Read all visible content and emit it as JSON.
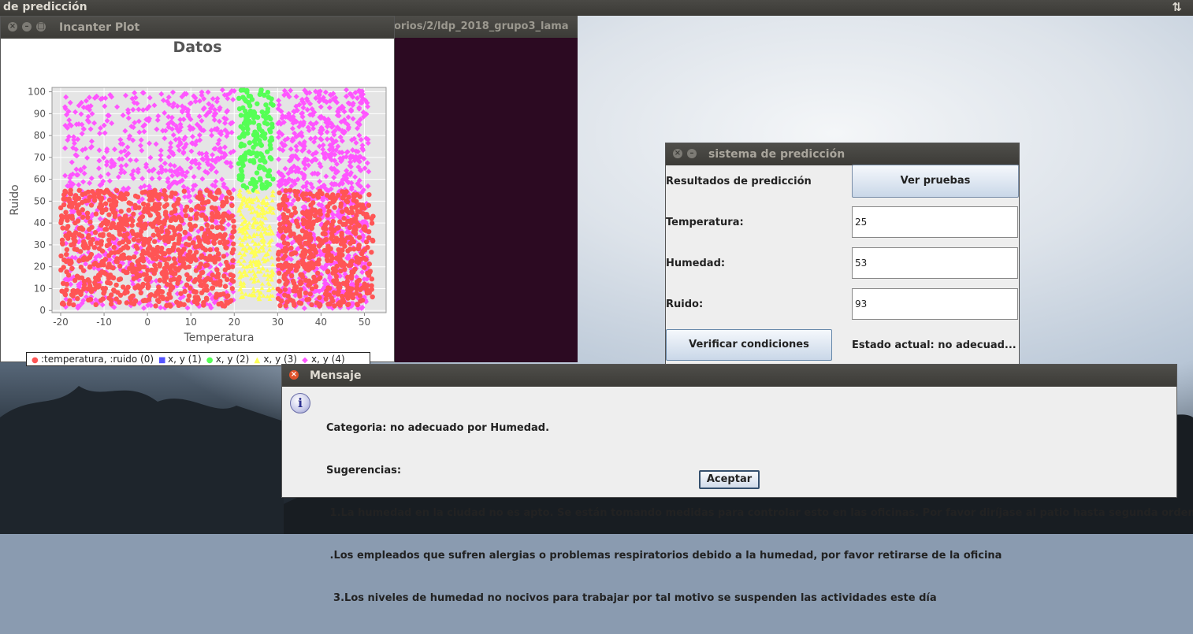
{
  "topbar": {
    "title": "de predicción",
    "indicator": "⇅"
  },
  "terminal": {
    "title": "orios/2/ldp_2018_grupo3_lama"
  },
  "incanter": {
    "title": "Incanter Plot"
  },
  "chart_data": {
    "type": "scatter",
    "title": "Datos",
    "xlabel": "Temperatura",
    "ylabel": "Ruido",
    "xlim": [
      -22,
      55
    ],
    "ylim": [
      -1,
      102
    ],
    "xticks": [
      "-20",
      "-10",
      "0",
      "10",
      "20",
      "30",
      "40",
      "50"
    ],
    "yticks": [
      "0",
      "10",
      "20",
      "30",
      "40",
      "50",
      "60",
      "70",
      "80",
      "90",
      "100"
    ],
    "grid": true,
    "legend_position": "bottom",
    "series": [
      {
        "name": ":temperatura, :ruido (0)",
        "color": "#ff5555",
        "marker": "circle",
        "regions": [
          {
            "x": [
              -20,
              20
            ],
            "y": [
              2,
              55
            ]
          },
          {
            "x": [
              30,
              52
            ],
            "y": [
              2,
              55
            ]
          }
        ]
      },
      {
        "name": "x, y (1)",
        "color": "#5555ff",
        "marker": "square",
        "regions": []
      },
      {
        "name": "x, y (2)",
        "color": "#55ff55",
        "marker": "circle",
        "regions": [
          {
            "x": [
              21,
              29
            ],
            "y": [
              55,
              101
            ]
          }
        ]
      },
      {
        "name": "x, y (3)",
        "color": "#ffff55",
        "marker": "triangle",
        "regions": [
          {
            "x": [
              21,
              29
            ],
            "y": [
              5,
              55
            ]
          }
        ]
      },
      {
        "name": "x, y (4)",
        "color": "#ff55ff",
        "marker": "diamond",
        "regions": [
          {
            "x": [
              -19,
              20
            ],
            "y": [
              1,
              101
            ]
          },
          {
            "x": [
              30,
              51
            ],
            "y": [
              1,
              101
            ]
          }
        ]
      }
    ]
  },
  "prediccion": {
    "title": "sistema de predicción",
    "resultados_label": "Resultados de predicción",
    "ver_pruebas": "Ver pruebas",
    "temperatura_label": "Temperatura:",
    "temperatura_value": "25",
    "humedad_label": "Humedad:",
    "humedad_value": "53",
    "ruido_label": "Ruido:",
    "ruido_value": "93",
    "verificar": "Verificar condiciones",
    "estado": "Estado actual: no adecuad..."
  },
  "mensaje": {
    "title": "Mensaje",
    "lines": [
      "Categoria: no adecuado por Humedad.",
      "Sugerencias:",
      " 1.La humedad en la ciudad no es apto. Se están tomando medidas para controlar esto en las oficinas. Por favor diríjase al patio hasta segunda orden",
      " .Los empleados que sufren alergias o problemas respiratorios debido a la humedad, por favor retirarse de la oficina",
      "  3.Los niveles de humedad no nocivos para trabajar por tal motivo se suspenden las actividades este día"
    ],
    "aceptar": "Aceptar"
  },
  "colors": {
    "accent_close": "#e0522b",
    "terminal_bg": "#2c0a22"
  }
}
